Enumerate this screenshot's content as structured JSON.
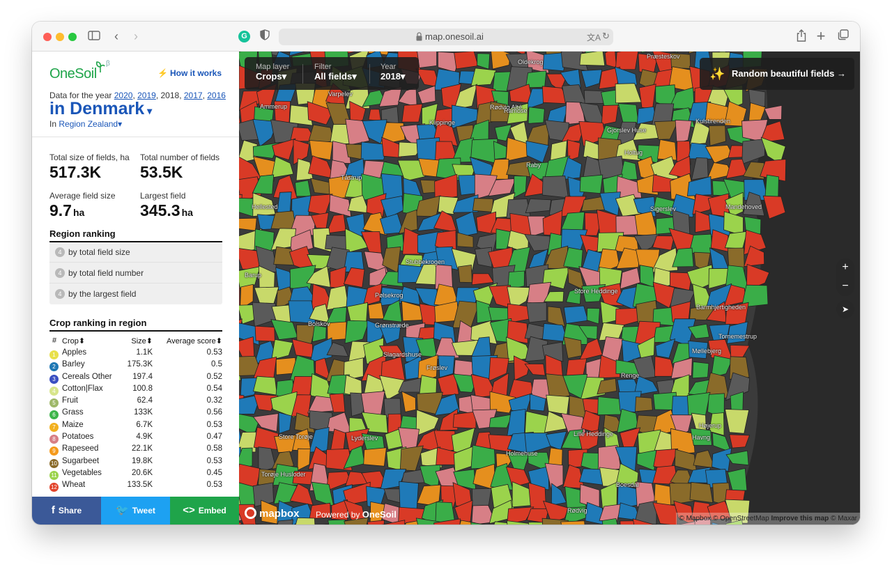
{
  "browser": {
    "url": "map.onesoil.ai",
    "icons": [
      "sidebar-icon",
      "back-icon",
      "forward-icon",
      "grammarly-icon",
      "shield-icon",
      "lock-icon",
      "translate-icon",
      "reload-icon",
      "share-icon",
      "plus-icon",
      "tabs-icon"
    ]
  },
  "sidebar": {
    "logo": "OneSoil",
    "beta": "β",
    "how_it_works": "How it works",
    "years_prefix": "Data for the year",
    "years": [
      "2020",
      "2019",
      "2018",
      "2017",
      "2016"
    ],
    "selected_year": "2018",
    "country": "in Denmark",
    "region_prefix": "In",
    "region": "Region Zealand",
    "stats": [
      {
        "label": "Total size of fields, ha",
        "value": "517.3K",
        "unit": ""
      },
      {
        "label": "Total number of fields",
        "value": "53.5K",
        "unit": ""
      },
      {
        "label": "Average field size",
        "value": "9.7",
        "unit": "ha"
      },
      {
        "label": "Largest field",
        "value": "345.3",
        "unit": "ha"
      }
    ],
    "region_ranking_title": "Region ranking",
    "region_ranking": [
      {
        "rank": "4",
        "label": "by total field size"
      },
      {
        "rank": "4",
        "label": "by total field number"
      },
      {
        "rank": "4",
        "label": "by the largest field"
      }
    ],
    "crop_ranking_title": "Crop ranking in region",
    "crop_table": {
      "headers": [
        "#",
        "Crop",
        "Size",
        "Average score"
      ],
      "rows": [
        {
          "n": "1",
          "crop": "Apples",
          "size": "1.1K",
          "score": "0.53",
          "color": "#e8e04a"
        },
        {
          "n": "2",
          "crop": "Barley",
          "size": "175.3K",
          "score": "0.5",
          "color": "#1f78b4"
        },
        {
          "n": "3",
          "crop": "Cereals Other",
          "size": "197.4",
          "score": "0.52",
          "color": "#3a4fc1"
        },
        {
          "n": "4",
          "crop": "Cotton|Flax",
          "size": "100.8",
          "score": "0.54",
          "color": "#d7e58a"
        },
        {
          "n": "5",
          "crop": "Fruit",
          "size": "62.4",
          "score": "0.32",
          "color": "#9fb86a"
        },
        {
          "n": "6",
          "crop": "Grass",
          "size": "133K",
          "score": "0.56",
          "color": "#3db54a"
        },
        {
          "n": "7",
          "crop": "Maize",
          "size": "6.7K",
          "score": "0.53",
          "color": "#f2b01e"
        },
        {
          "n": "8",
          "crop": "Potatoes",
          "size": "4.9K",
          "score": "0.47",
          "color": "#d77f86"
        },
        {
          "n": "9",
          "crop": "Rapeseed",
          "size": "22.1K",
          "score": "0.58",
          "color": "#f59a1b"
        },
        {
          "n": "10",
          "crop": "Sugarbeet",
          "size": "19.8K",
          "score": "0.53",
          "color": "#8a6b2a"
        },
        {
          "n": "11",
          "crop": "Vegetables",
          "size": "20.6K",
          "score": "0.45",
          "color": "#9bd34c"
        },
        {
          "n": "12",
          "crop": "Wheat",
          "size": "133.5K",
          "score": "0.53",
          "color": "#e2442b"
        }
      ]
    },
    "share": {
      "facebook": "Share",
      "twitter": "Tweet",
      "embed": "Embed"
    }
  },
  "map": {
    "filters": [
      {
        "label": "Map layer",
        "value": "Crops"
      },
      {
        "label": "Filter",
        "value": "All fields"
      },
      {
        "label": "Year",
        "value": "2018"
      }
    ],
    "random_button": "Random beautiful fields →",
    "zoom_in": "+",
    "zoom_out": "−",
    "mapbox": "mapbox",
    "powered_prefix": "Powered by",
    "powered_brand": "OneSoil",
    "attribution_1": "© Mapbox © OpenStreetMap",
    "attribution_2": "Improve this map",
    "attribution_3": "© Maxar",
    "places": [
      "Præsteskov",
      "Oldekrog",
      "Varpelev",
      "Ammerup",
      "Klippinge",
      "Rødvig Alté",
      "Ramose",
      "Gjorslev Huse",
      "Kulstirenden",
      "Holtug",
      "Raby",
      "Tåstrup",
      "Hellested",
      "Sigerslev",
      "Mandehoved",
      "Stubbekrogen",
      "Barup",
      "Store Heddinge",
      "Pølsekrog",
      "Barmhjertigheden",
      "Bolskov",
      "Grønstræde",
      "Tornemestrup",
      "Slagardshuse",
      "Frøslev",
      "Møllebjerg",
      "Renge",
      "Højerup",
      "Store Torøje",
      "Lyderslev",
      "Lille Heddinge",
      "Havng",
      "Holmehuse",
      "Torøje Husloder",
      "Boesdal",
      "Rødvig"
    ]
  }
}
